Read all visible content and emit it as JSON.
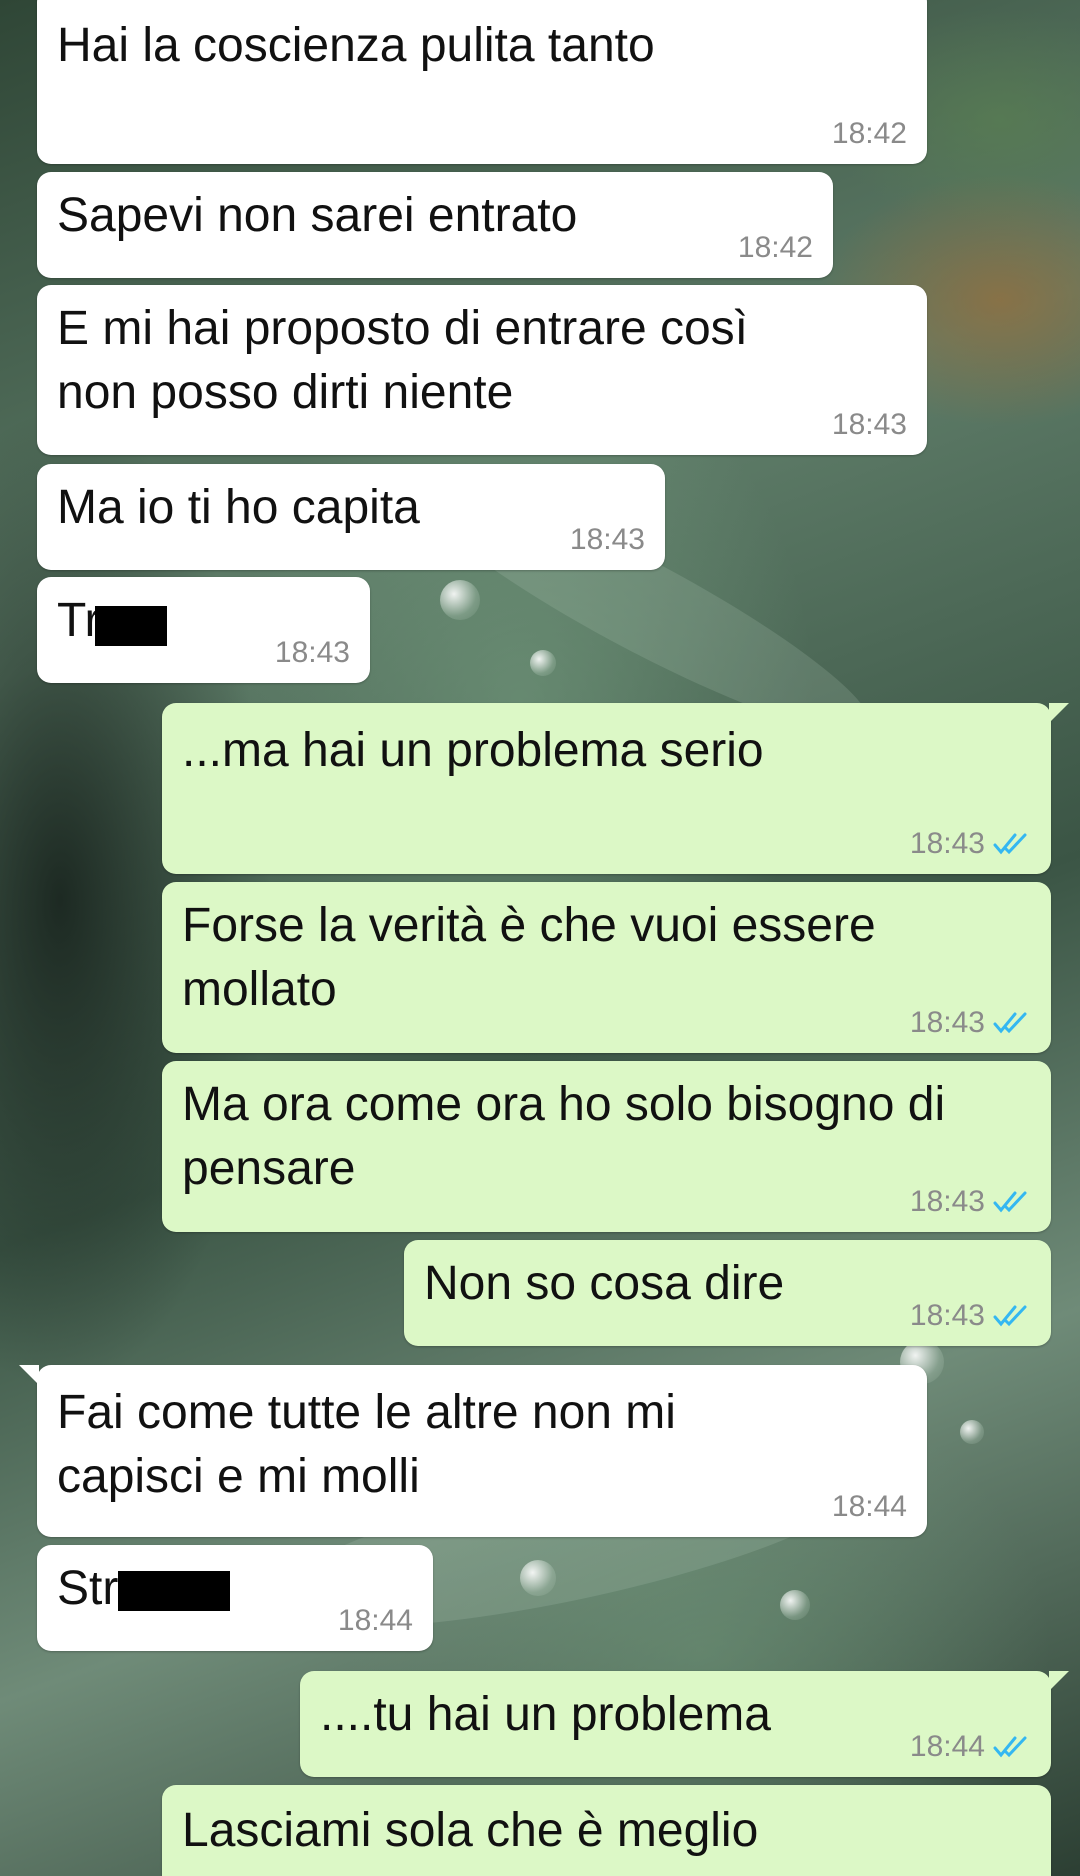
{
  "messages": [
    {
      "dir": "in",
      "text": "Hai la coscienza pulita tanto",
      "time": "18:42"
    },
    {
      "dir": "in",
      "text": "Sapevi non sarei entrato",
      "time": "18:42"
    },
    {
      "dir": "in",
      "text": "E mi hai proposto di entrare così non posso dirti niente",
      "time": "18:43"
    },
    {
      "dir": "in",
      "text": "Ma io ti ho capita",
      "time": "18:43"
    },
    {
      "dir": "in",
      "text": "Tr",
      "time": "18:43",
      "redacted": true
    },
    {
      "dir": "out",
      "text": "...ma hai un problema serio",
      "time": "18:43",
      "ticks": "double-check-icon"
    },
    {
      "dir": "out",
      "text": "Forse la verità è che vuoi essere mollato",
      "time": "18:43",
      "ticks": "double-check-icon"
    },
    {
      "dir": "out",
      "text": "Ma ora come ora ho solo bisogno di pensare",
      "time": "18:43",
      "ticks": "double-check-icon"
    },
    {
      "dir": "out",
      "text": "Non so cosa dire",
      "time": "18:43",
      "ticks": "double-check-icon"
    },
    {
      "dir": "in",
      "text": "Fai come tutte le altre non mi capisci e mi molli",
      "time": "18:44"
    },
    {
      "dir": "in",
      "text": "Str",
      "time": "18:44",
      "redacted": true
    },
    {
      "dir": "out",
      "text": "....tu hai un problema",
      "time": "18:44",
      "ticks": "double-check-icon"
    },
    {
      "dir": "out",
      "text": "Lasciami sola che è meglio",
      "time": ""
    }
  ],
  "colors": {
    "incoming_bubble": "#ffffff",
    "outgoing_bubble": "#dcf8c6",
    "timestamp": "#8a8a8a",
    "read_ticks": "#34b7f1"
  }
}
